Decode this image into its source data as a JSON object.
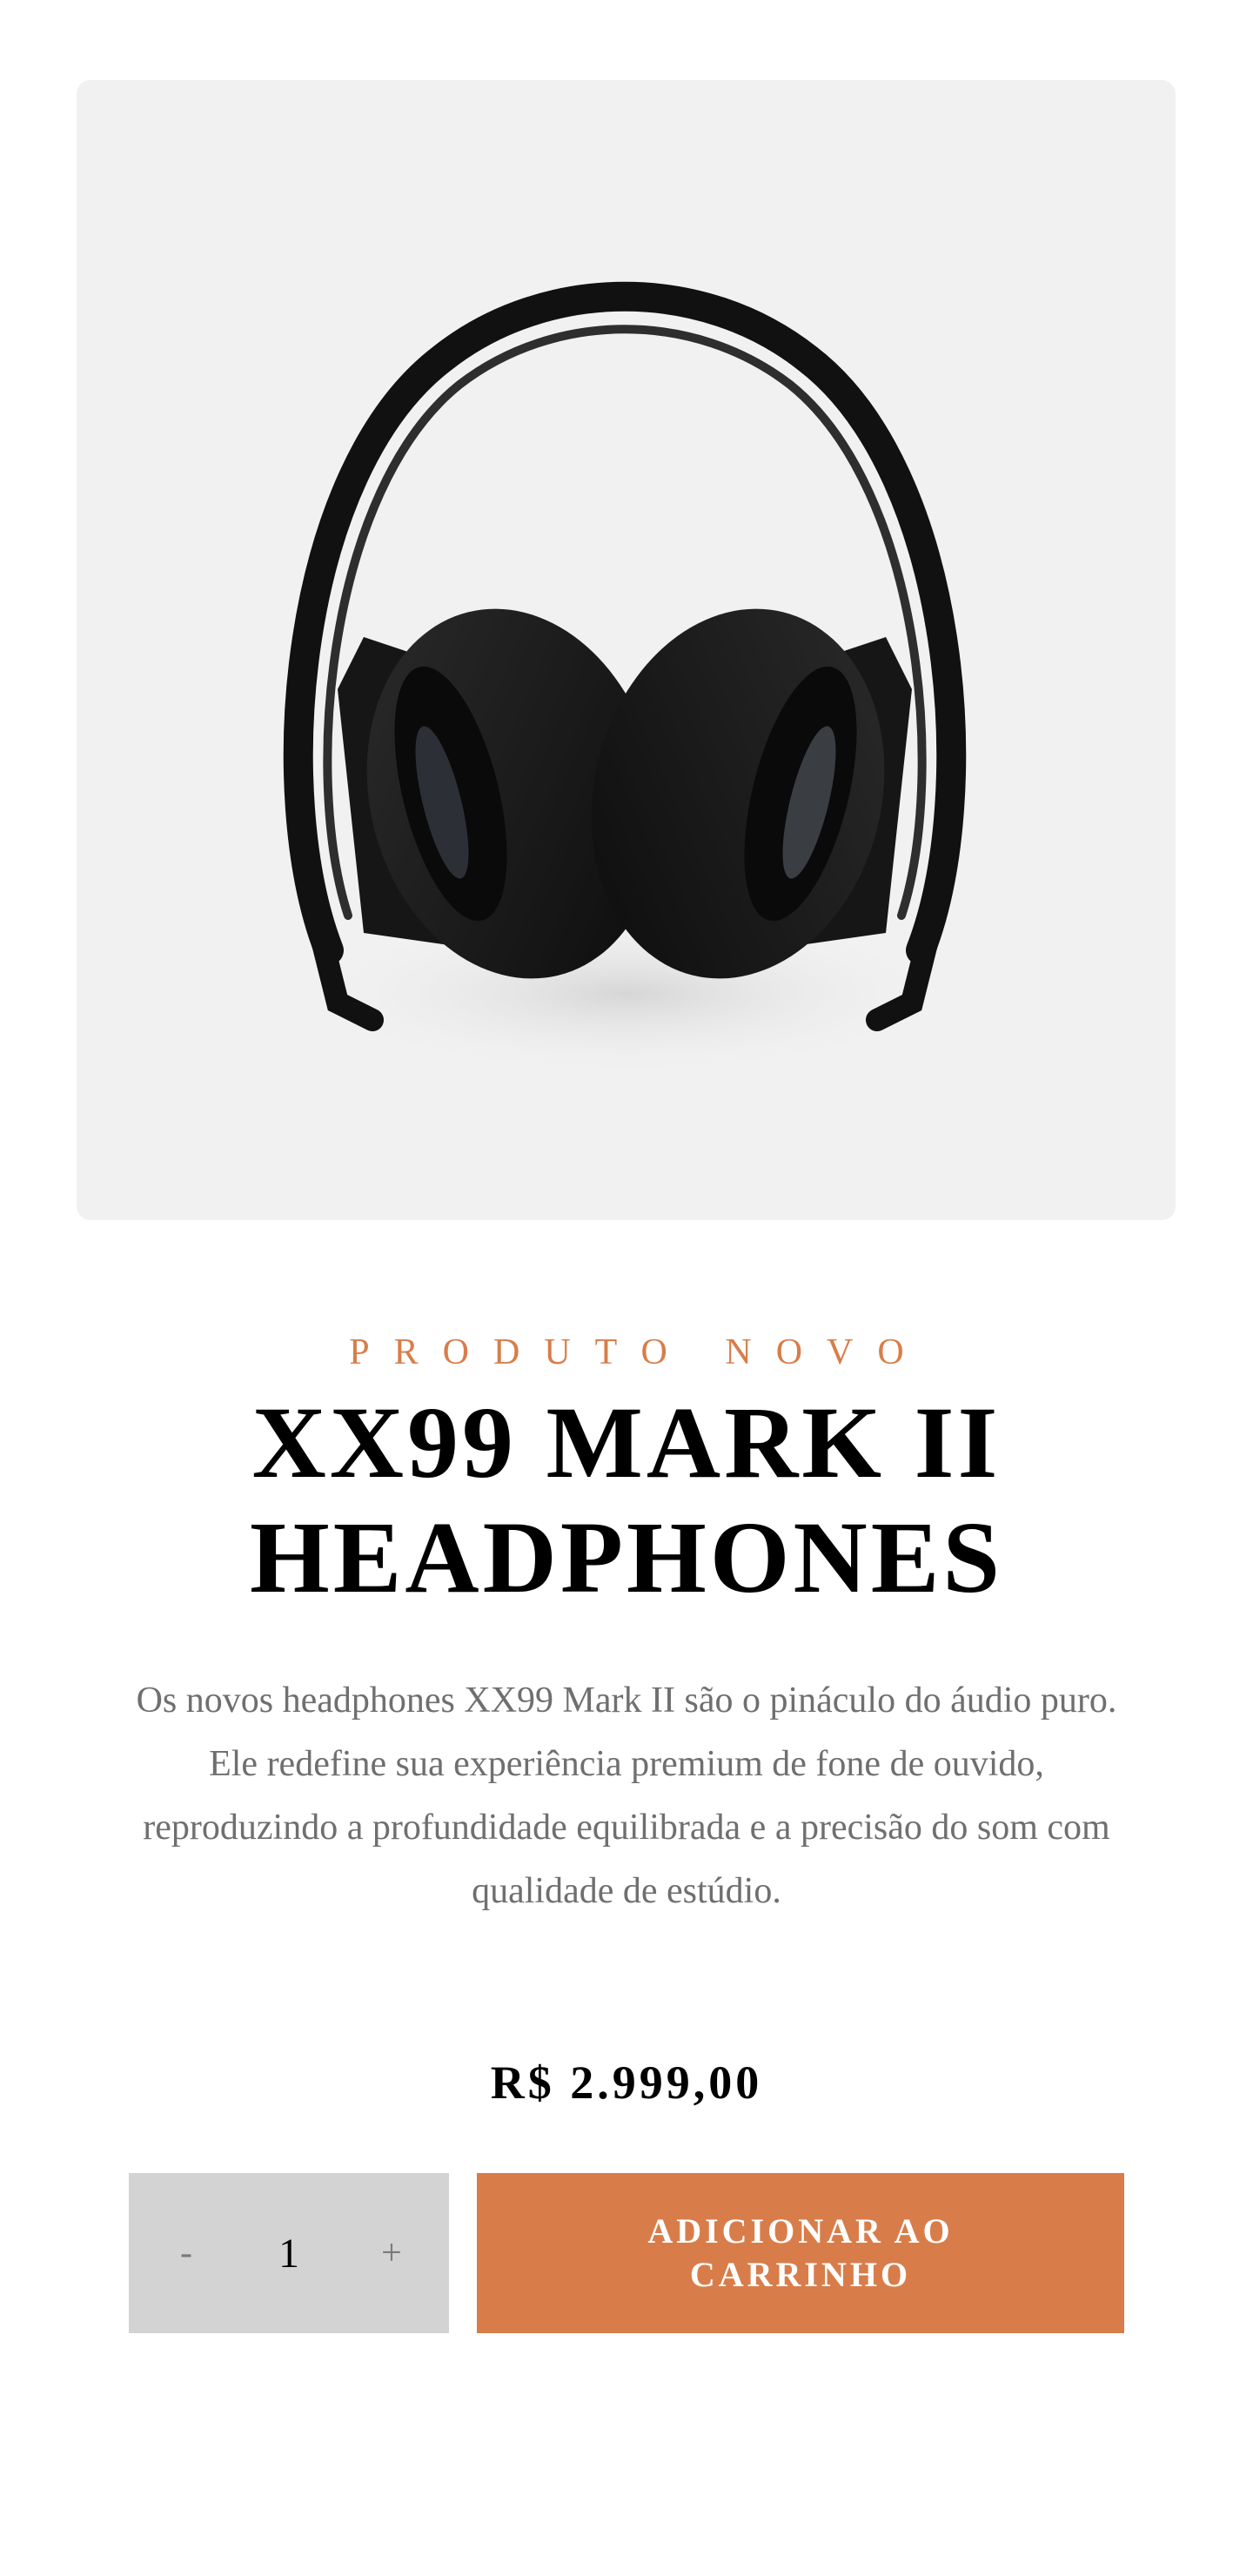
{
  "product": {
    "image_alt": "headphones-image",
    "overline": "PRODUTO NOVO",
    "title_line1": "XX99 MARK II",
    "title_line2": "HEADPHONES",
    "description": "Os novos headphones XX99 Mark II são o pináculo do áudio puro. Ele redefine sua experiência premium de fone de ouvido, reproduzindo a profundidade equilibrada e a precisão do som com qualidade de estúdio.",
    "price": "R$ 2.999,00"
  },
  "cart": {
    "decrement_label": "-",
    "quantity": "1",
    "increment_label": "+",
    "add_label": "ADICIONAR AO CARRINHO"
  },
  "colors": {
    "accent": "#d87d4a",
    "image_bg": "#f1f1f1",
    "quantity_bg": "#d3d3d3",
    "text_muted": "#6f6f6f"
  }
}
